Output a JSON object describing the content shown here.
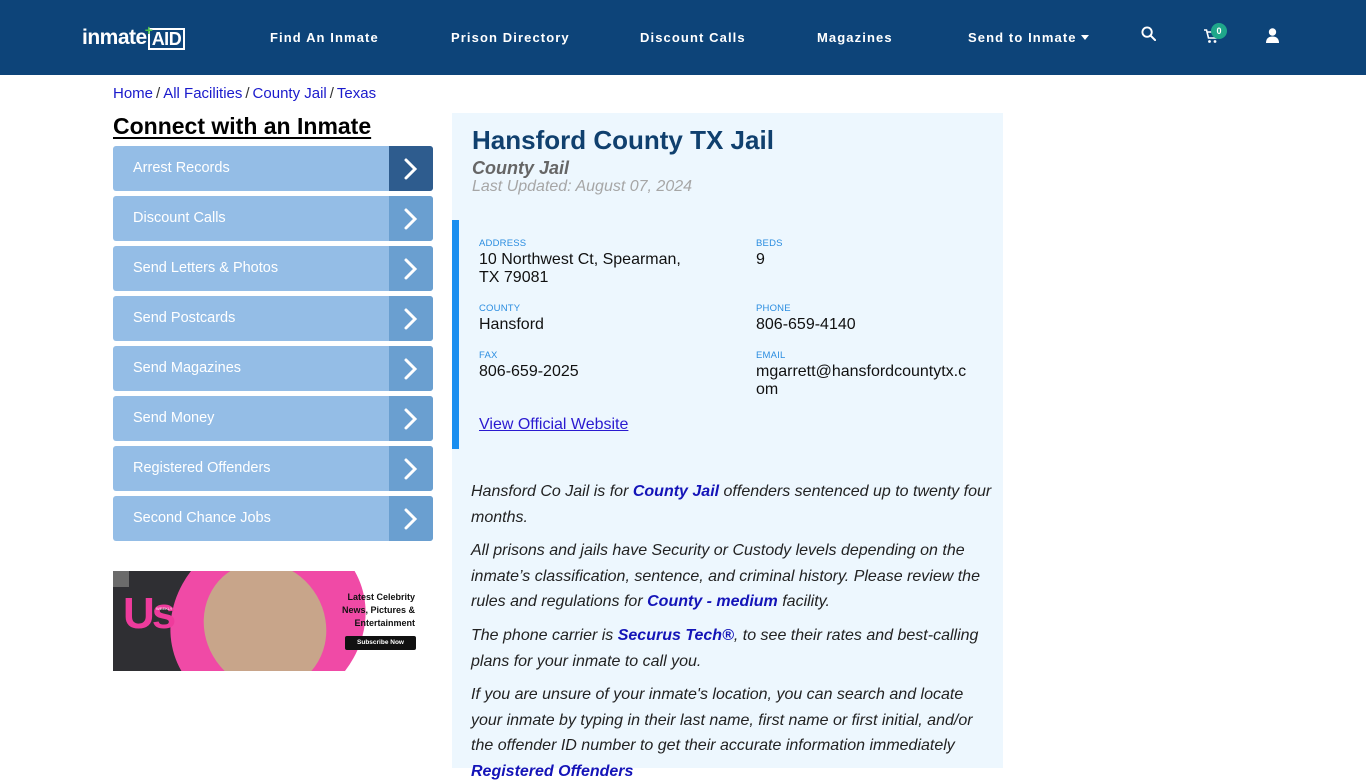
{
  "header": {
    "logo_text_1": "inmate",
    "logo_text_2": "AID",
    "nav": [
      {
        "label": "Find An Inmate"
      },
      {
        "label": "Prison Directory"
      },
      {
        "label": "Discount Calls"
      },
      {
        "label": "Magazines"
      },
      {
        "label": "Send to Inmate"
      }
    ],
    "cart_count": "0",
    "icons": [
      "search-icon",
      "cart-icon",
      "user-icon"
    ]
  },
  "breadcrumb": [
    "Home",
    "All Facilities",
    "County Jail",
    "Texas"
  ],
  "sidebar": {
    "title": "Connect with an Inmate",
    "items": [
      {
        "label": "Arrest Records"
      },
      {
        "label": "Discount Calls"
      },
      {
        "label": "Send Letters & Photos"
      },
      {
        "label": "Send Postcards"
      },
      {
        "label": "Send Magazines"
      },
      {
        "label": "Send Money"
      },
      {
        "label": "Registered Offenders"
      },
      {
        "label": "Second Chance Jobs"
      }
    ],
    "ad": {
      "brand": "Us",
      "brand_small": "WEEKLY",
      "line1": "Latest Celebrity",
      "line2": "News, Pictures &",
      "line3": "Entertainment",
      "cta": "Subscribe Now"
    }
  },
  "facility": {
    "name": "Hansford County TX Jail",
    "type": "County Jail",
    "last_updated": "Last Updated: August 07, 2024",
    "address_label": "ADDRESS",
    "address_line1": "10 Northwest Ct, Spearman,",
    "address_line2": "TX 79081",
    "beds_label": "BEDS",
    "beds": "9",
    "county_label": "COUNTY",
    "county": "Hansford",
    "phone_label": "PHONE",
    "phone": "806-659-4140",
    "fax_label": "FAX",
    "fax": "806-659-2025",
    "email_label": "EMAIL",
    "email_line1": "mgarrett@hansfordcountytx.c",
    "email_line2": "om",
    "website_link": "View Official Website"
  },
  "content": {
    "p1_a": "Hansford Co Jail is for ",
    "p1_link": "County Jail",
    "p1_b": " offenders sentenced up to twenty four months.",
    "p2_a": "All prisons and jails have Security or Custody levels depending on the inmate’s classification, sentence, and criminal history. Please review the rules and regulations for ",
    "p2_link": "County - medium",
    "p2_b": " facility.",
    "p3_a": "The phone carrier is ",
    "p3_link": "Securus Tech®",
    "p3_b": ", to see their rates and best-calling plans for your inmate to call you.",
    "p4_a": "If you are unsure of your inmate's location, you can search and locate your inmate by typing in their last name, first name or first initial, and/or the offender ID number to get their accurate information immediately ",
    "p4_link": "Registered Offenders"
  }
}
